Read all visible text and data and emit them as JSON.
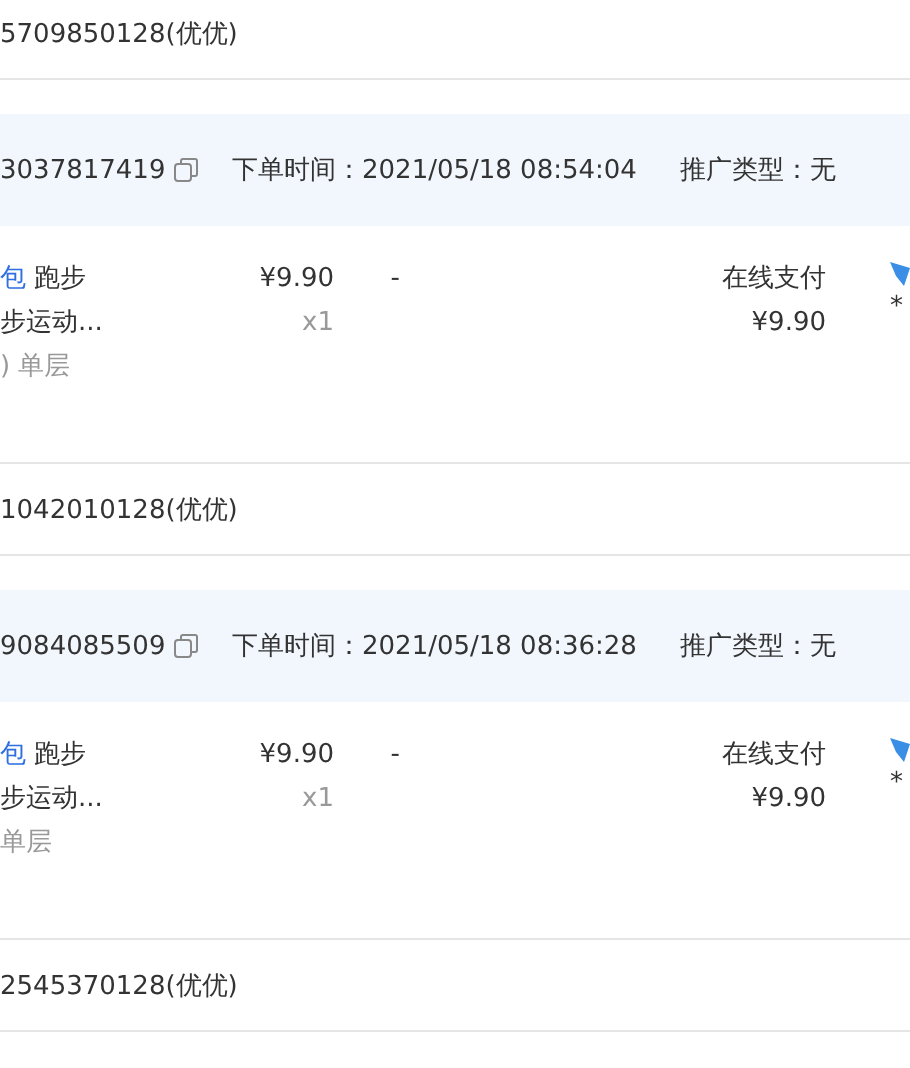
{
  "list": [
    {
      "kind": "buyer",
      "text": "5709850128(优优)"
    },
    {
      "kind": "order",
      "order_id": "3037817419",
      "order_time": "下单时间：2021/05/18 08:54:04",
      "promo": "推广类型：无",
      "product": {
        "tag": "包",
        "line_1": "跑步",
        "line_2": "步运动...",
        "spec": ") 单层"
      },
      "price": "¥9.90",
      "quantity": "x1",
      "discount": "-",
      "payment_method": "在线支付",
      "paid": "¥9.90",
      "column_7": "*"
    },
    {
      "kind": "buyer",
      "text": "1042010128(优优)"
    },
    {
      "kind": "order",
      "order_id": "9084085509",
      "order_time": "下单时间：2021/05/18 08:36:28",
      "promo": "推广类型：无",
      "product": {
        "tag": "包",
        "line_1": "跑步",
        "line_2": "步运动...",
        "spec": "单层"
      },
      "price": "¥9.90",
      "quantity": "x1",
      "discount": "-",
      "payment_method": "在线支付",
      "paid": "¥9.90",
      "column_7": "*"
    },
    {
      "kind": "buyer",
      "text": "2545370128(优优)"
    }
  ]
}
